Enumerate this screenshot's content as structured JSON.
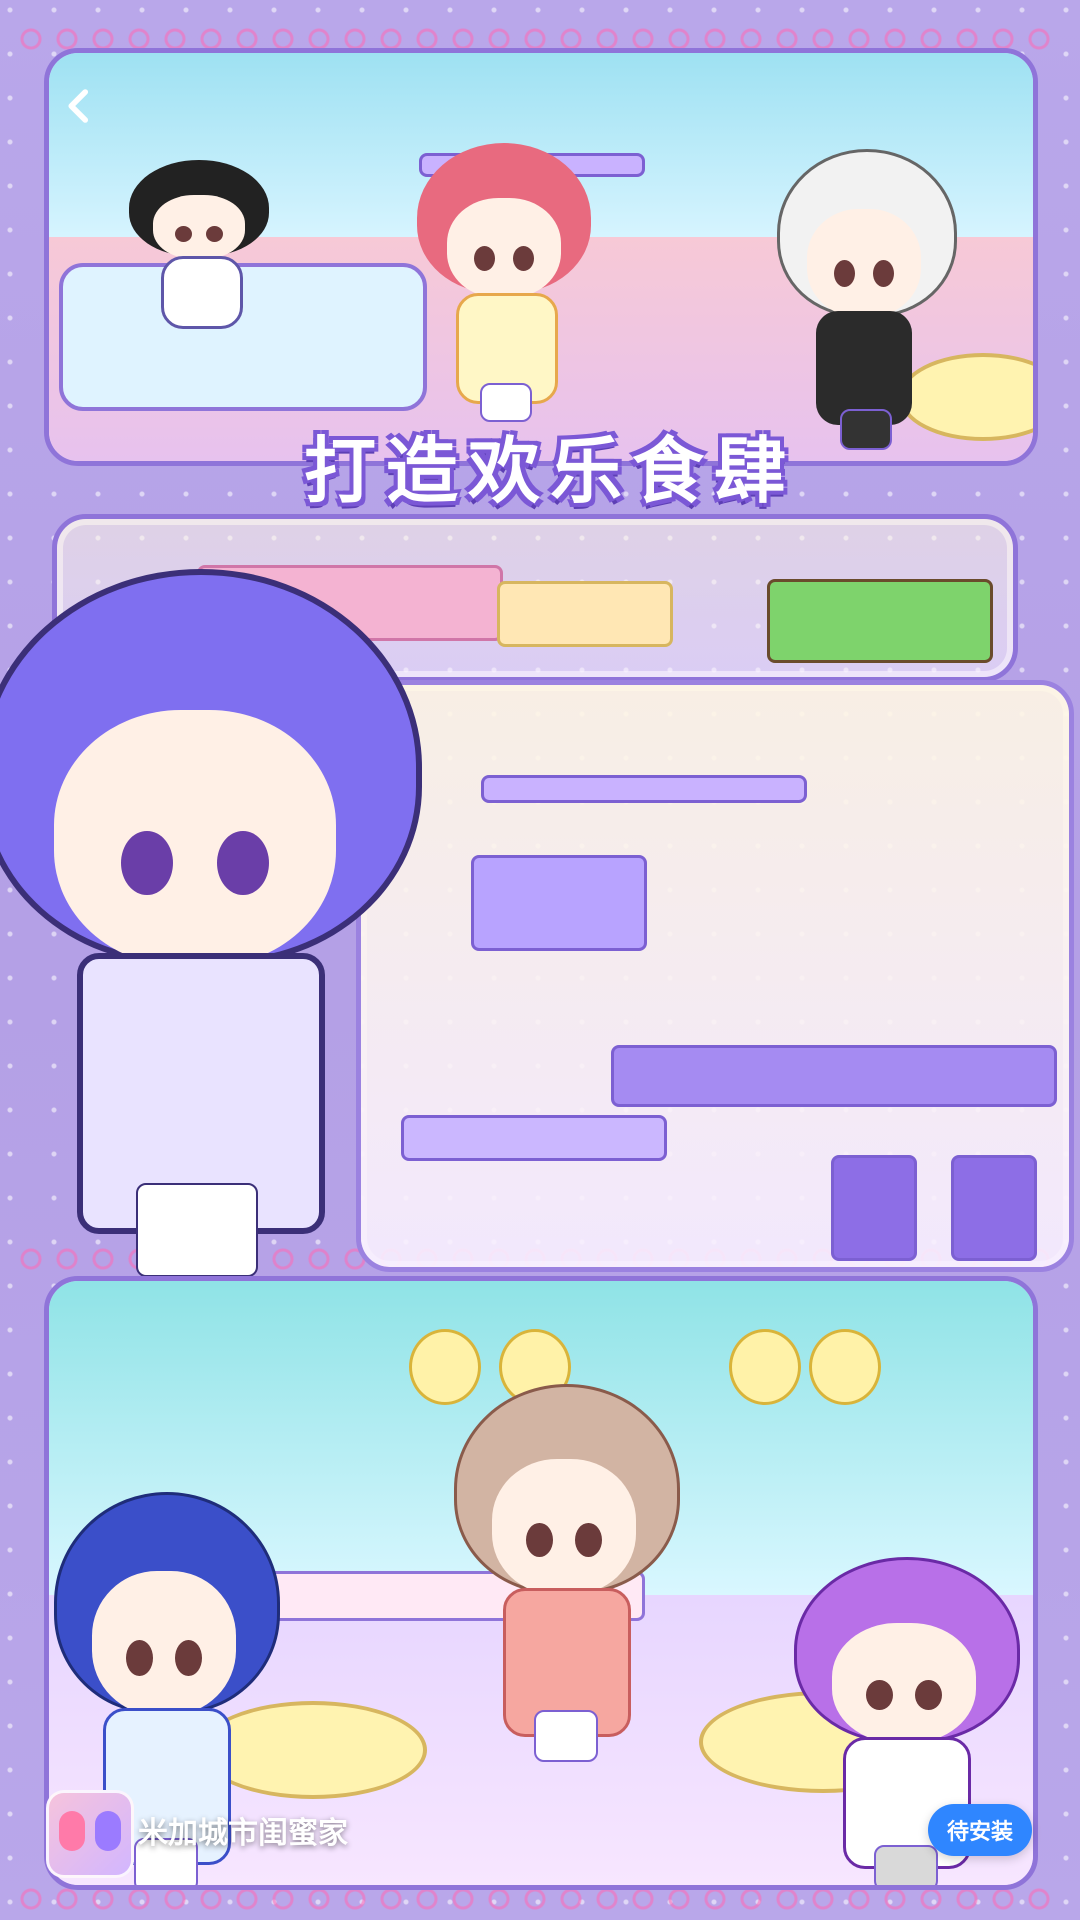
{
  "header": {
    "back_icon": "back-chevron-icon"
  },
  "banner": {
    "title": "打造欢乐食肆"
  },
  "bottom_bar": {
    "app_name": "米加城市闺蜜家",
    "install_label": "待安装",
    "app_icon": "app-icon"
  },
  "colors": {
    "background": "#b8a6e8",
    "accent": "#2f86ff",
    "frame": "#8f74d9"
  }
}
